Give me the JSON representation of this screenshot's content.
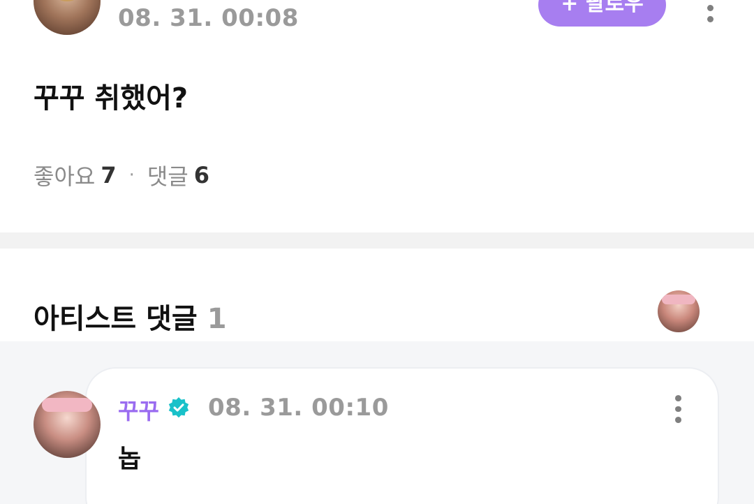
{
  "post": {
    "timestamp": "08. 31. 00:08",
    "follow_label": "+ 팔로우",
    "text": "꾸꾸 취했어?",
    "likes_label": "좋아요",
    "likes_count": "7",
    "separator": "·",
    "comments_label": "댓글",
    "comments_count": "6"
  },
  "artist_comments": {
    "title": "아티스트 댓글",
    "count": "1"
  },
  "comment": {
    "author": "꾸꾸",
    "timestamp": "08. 31. 00:10",
    "text": "놉"
  },
  "icons": {
    "more": "more-vertical-icon",
    "verified": "verified-badge-icon"
  },
  "colors": {
    "accent": "#a77ef0",
    "author_name": "#9a6cf0",
    "verified": "#19c1c9"
  }
}
